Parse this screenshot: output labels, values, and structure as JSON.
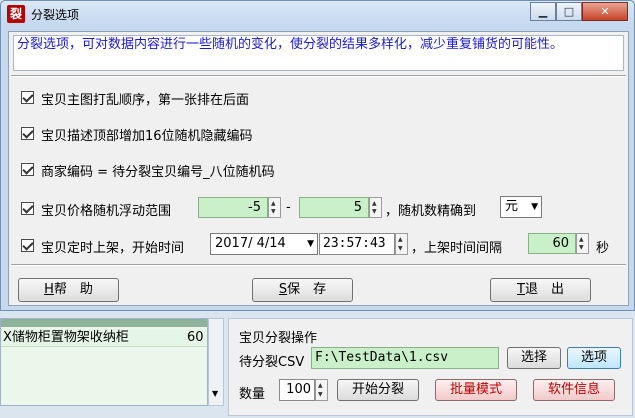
{
  "dialog": {
    "title": "分裂选项",
    "app_icon_char": "裂",
    "info_text": "分裂选项，可对数据内容进行一些随机的变化，使分裂的结果多样化，减少重复铺货的可能性。",
    "options": [
      {
        "label": "宝贝主图打乱顺序，第一张排在后面",
        "checked": true
      },
      {
        "label": "宝贝描述顶部增加16位随机隐藏编码",
        "checked": true
      },
      {
        "label": "商家编码 = 待分裂宝贝编号_八位随机码",
        "checked": true
      }
    ],
    "price": {
      "label": "宝贝价格随机浮动范围",
      "min": "-5",
      "dash": "-",
      "max": "5",
      "precision_label": "，随机数精确到",
      "precision_value": "元"
    },
    "schedule": {
      "label": "宝贝定时上架，开始时间",
      "date": "2017/ 4/14",
      "time": "23:57:43",
      "interval_label": "，上架时间间隔",
      "interval_value": "60",
      "interval_unit": "秒"
    },
    "buttons": {
      "help_key": "H",
      "help_text": "帮　助",
      "save_key": "S",
      "save_text": "保　存",
      "exit_key": "T",
      "exit_text": "退　出"
    }
  },
  "background": {
    "list_row_text": "X储物柜置物架收纳柜",
    "list_row_value": "60",
    "panel_title": "宝贝分裂操作",
    "csv_label": "待分裂CSV",
    "csv_path": "F:\\TestData\\1.csv",
    "choose_button": "选择",
    "options_button": "选项",
    "quantity_label": "数量",
    "quantity_value": "100",
    "start_button": "开始分裂",
    "batch_button": "批量模式",
    "software_info_button": "软件信息"
  }
}
